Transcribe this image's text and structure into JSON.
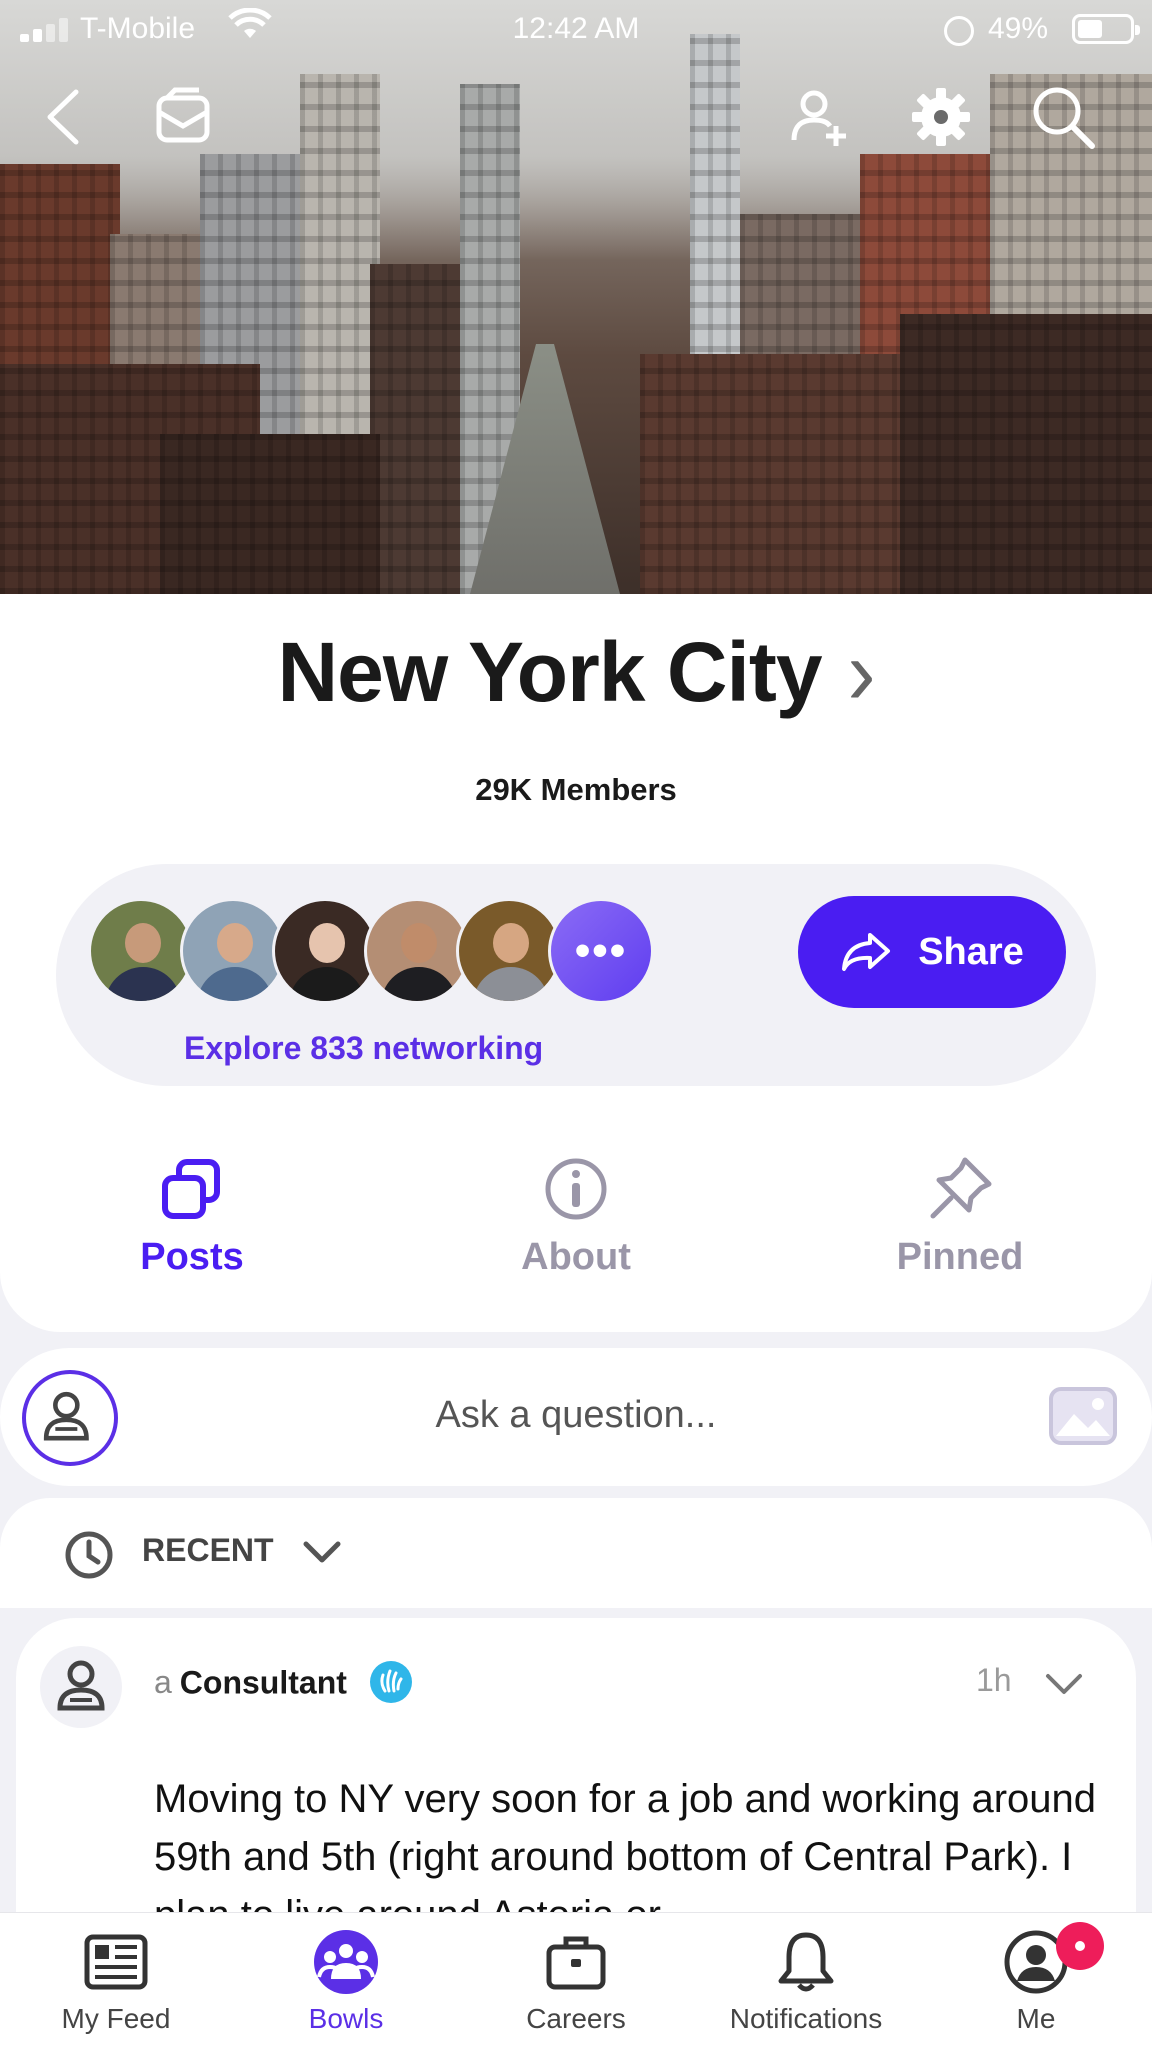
{
  "status_bar": {
    "carrier": "T-Mobile",
    "time": "12:42 AM",
    "battery": "49%"
  },
  "group": {
    "name": "New York City",
    "members": "29K Members",
    "explore_text": "Explore 833 networking",
    "share_label": "Share"
  },
  "tabs": [
    {
      "label": "Posts",
      "icon": "posts-icon",
      "active": true
    },
    {
      "label": "About",
      "icon": "info-icon",
      "active": false
    },
    {
      "label": "Pinned",
      "icon": "pin-icon",
      "active": false
    }
  ],
  "composer": {
    "placeholder": "Ask a question..."
  },
  "sort": {
    "label": "RECENT"
  },
  "post": {
    "article": "a",
    "role": "Consultant",
    "time": "1h",
    "body": "Moving to NY very soon for a job and working around 59th and 5th (right around bottom of Central Park). I plan to live around Astoria or"
  },
  "bottom_nav": [
    {
      "label": "My Feed",
      "icon": "feed-icon"
    },
    {
      "label": "Bowls",
      "icon": "bowls-icon",
      "active": true
    },
    {
      "label": "Careers",
      "icon": "briefcase-icon"
    },
    {
      "label": "Notifications",
      "icon": "bell-icon"
    },
    {
      "label": "Me",
      "icon": "profile-icon"
    }
  ],
  "colors": {
    "accent": "#4a1df2",
    "link": "#5b2fe6",
    "badge": "#2fb6e9",
    "notification": "#ee1d5a"
  }
}
